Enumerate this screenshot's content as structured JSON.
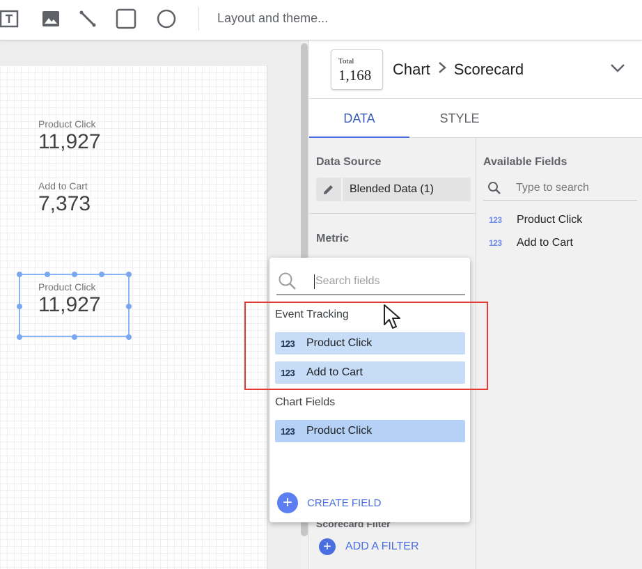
{
  "toolbar": {
    "tools": [
      "text-box-icon",
      "image-icon",
      "line-icon",
      "rectangle-icon",
      "circle-icon"
    ],
    "layout_theme_label": "Layout and theme..."
  },
  "canvas": {
    "scorecards": [
      {
        "label": "Product Click",
        "value": "11,927"
      },
      {
        "label": "Add to Cart",
        "value": "7,373"
      }
    ],
    "selected_scorecard": {
      "label": "Product Click",
      "value": "11,927"
    }
  },
  "panel": {
    "thumbnail": {
      "label": "Total",
      "value": "1,168"
    },
    "breadcrumb": {
      "parent": "Chart",
      "current": "Scorecard"
    },
    "tabs": [
      {
        "label": "DATA",
        "active": true
      },
      {
        "label": "STYLE",
        "active": false
      }
    ],
    "data_source_title": "Data Source",
    "data_source_name": "Blended Data (1)",
    "metric_title": "Metric",
    "scorecard_filter_title": "Scorecard Filter",
    "add_filter_label": "ADD A FILTER",
    "available_fields": {
      "title": "Available Fields",
      "search_placeholder": "Type to search",
      "fields": [
        {
          "type_badge": "123",
          "label": "Product Click"
        },
        {
          "type_badge": "123",
          "label": "Add to Cart"
        }
      ]
    }
  },
  "dropdown": {
    "search_placeholder": "Search fields",
    "groups": [
      {
        "title": "Event Tracking",
        "fields": [
          {
            "type_badge": "123",
            "label": "Product Click"
          },
          {
            "type_badge": "123",
            "label": "Add to Cart"
          }
        ]
      },
      {
        "title": "Chart Fields",
        "fields": [
          {
            "type_badge": "123",
            "label": "Product Click"
          }
        ]
      }
    ],
    "create_field_label": "CREATE FIELD"
  },
  "colors": {
    "accent": "#4a6ee0",
    "highlight": "#e53935",
    "field_chip": "#c6dcf7"
  }
}
